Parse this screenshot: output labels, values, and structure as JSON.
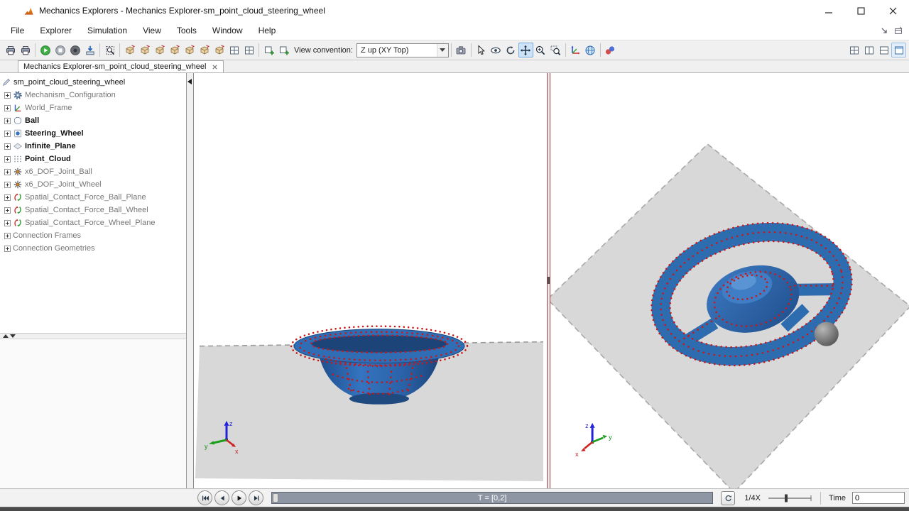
{
  "window": {
    "title": "Mechanics Explorers - Mechanics Explorer-sm_point_cloud_steering_wheel"
  },
  "menu": {
    "items": [
      "File",
      "Explorer",
      "Simulation",
      "View",
      "Tools",
      "Window",
      "Help"
    ]
  },
  "toolbar": {
    "view_convention_label": "View convention:",
    "view_convention_value": "Z up (XY Top)"
  },
  "tab": {
    "label": "Mechanics Explorer-sm_point_cloud_steering_wheel"
  },
  "tree": {
    "items": [
      {
        "label": "sm_point_cloud_steering_wheel",
        "icon": "model"
      },
      {
        "label": "Mechanism_Configuration",
        "icon": "gear"
      },
      {
        "label": "World_Frame",
        "icon": "frame"
      },
      {
        "label": "Ball",
        "icon": "sphere",
        "bold": true
      },
      {
        "label": "Steering_Wheel",
        "icon": "body",
        "bold": true
      },
      {
        "label": "Infinite_Plane",
        "icon": "plane",
        "bold": true
      },
      {
        "label": "Point_Cloud",
        "icon": "points",
        "bold": true
      },
      {
        "label": "x6_DOF_Joint_Ball",
        "icon": "joint"
      },
      {
        "label": "x6_DOF_Joint_Wheel",
        "icon": "joint"
      },
      {
        "label": "Spatial_Contact_Force_Ball_Plane",
        "icon": "force"
      },
      {
        "label": "Spatial_Contact_Force_Ball_Wheel",
        "icon": "force"
      },
      {
        "label": "Spatial_Contact_Force_Wheel_Plane",
        "icon": "force"
      },
      {
        "label": "Connection Frames",
        "icon": "none"
      },
      {
        "label": "Connection Geometries",
        "icon": "none"
      }
    ]
  },
  "viewport": {
    "axis_x": "x",
    "axis_y": "y",
    "axis_z": "z"
  },
  "playback": {
    "range_label": "T = [0,2]",
    "speed": "1/4X",
    "time_label": "Time",
    "time_value": "0"
  },
  "colors": {
    "model_blue": "#2e6cb0",
    "point_red": "#cc1616",
    "plane_gray": "#d8d8d8"
  }
}
